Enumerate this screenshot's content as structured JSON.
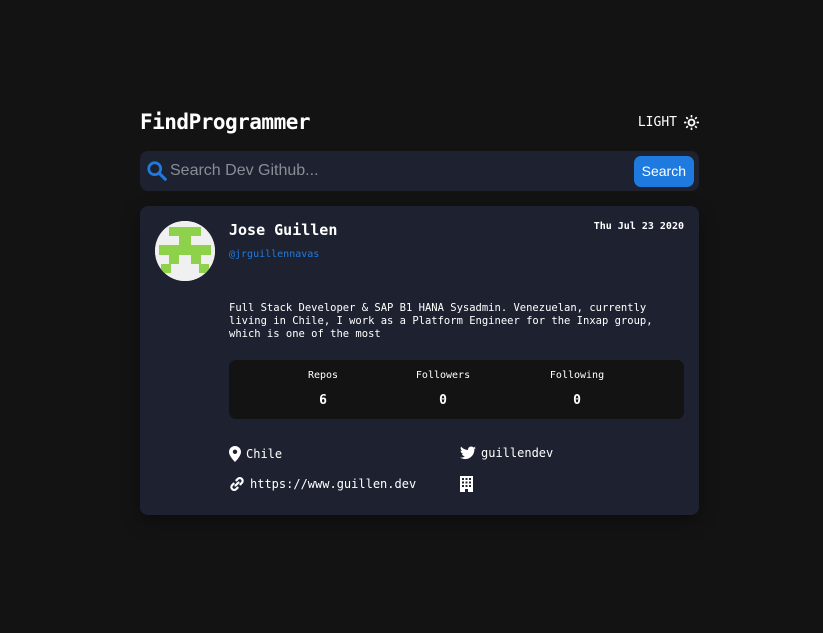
{
  "header": {
    "app_title": "FindProgrammer",
    "theme_toggle_label": "LIGHT",
    "theme_icon": "sun-icon"
  },
  "search": {
    "placeholder": "Search Dev Github...",
    "value": "",
    "button_label": "Search",
    "icon": "search-icon"
  },
  "profile": {
    "name": "Jose Guillen",
    "login": "@jrguillennavas",
    "joined": "Thu Jul 23 2020",
    "bio": "Full Stack Developer & SAP B1 HANA Sysadmin. Venezuelan, currently living in Chile, I work as a Platform Engineer for the Inxap group, which is one of the most",
    "stats": [
      {
        "label": "Repos",
        "value": "6"
      },
      {
        "label": "Followers",
        "value": "0"
      },
      {
        "label": "Following",
        "value": "0"
      }
    ],
    "location": "Chile",
    "twitter": "guillendev",
    "blog": "https://www.guillen.dev",
    "company": ""
  },
  "colors": {
    "background": "#131313",
    "card": "#1e2230",
    "accent": "#1f7ae0",
    "avatar_identicon": "#8ed14a"
  }
}
